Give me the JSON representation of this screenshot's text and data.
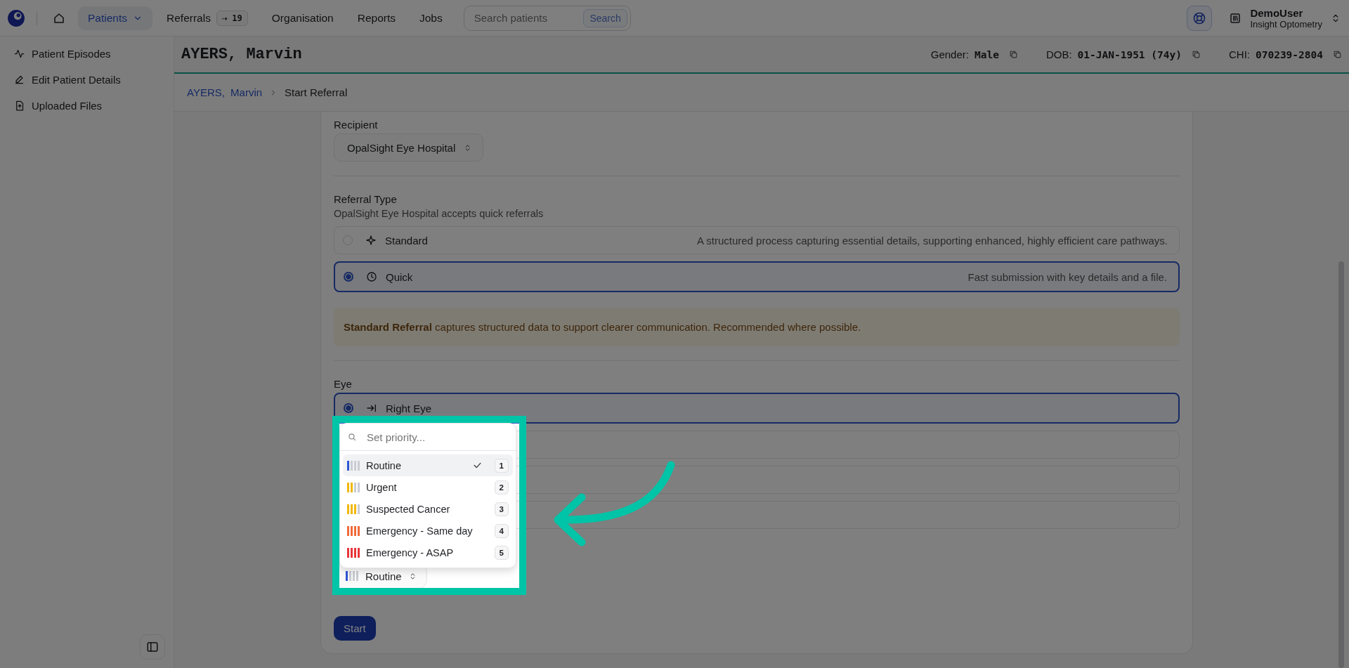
{
  "topbar": {
    "nav": [
      {
        "label": "Patients",
        "selected": true,
        "kind": "menu"
      },
      {
        "label": "Referrals",
        "badge": "⇢ 19",
        "selected": false,
        "kind": "badge"
      },
      {
        "label": "Organisation",
        "selected": false,
        "kind": "plain"
      },
      {
        "label": "Reports",
        "selected": false,
        "kind": "plain"
      },
      {
        "label": "Jobs",
        "selected": false,
        "kind": "plain"
      }
    ],
    "search": {
      "placeholder": "Search patients",
      "button": "Search"
    },
    "user": {
      "name": "DemoUser",
      "org": "Insight Optometry"
    }
  },
  "sidebar": {
    "items": [
      {
        "label": "Patient Episodes",
        "kind": "pulse"
      },
      {
        "label": "Edit Patient Details",
        "kind": "pen"
      },
      {
        "label": "Uploaded Files",
        "kind": "file"
      }
    ]
  },
  "patient": {
    "name": "AYERS, Marvin",
    "details": [
      {
        "label": "Gender:",
        "value": "Male"
      },
      {
        "label": "DOB:",
        "value": "01-JAN-1951 (74y)"
      },
      {
        "label": "CHI:",
        "value": "070239-2804"
      }
    ]
  },
  "breadcrumb": [
    {
      "label": "AYERS, Marvin",
      "link": true
    },
    {
      "label": "Start Referral",
      "link": false
    }
  ],
  "form": {
    "recipient": {
      "label": "Recipient",
      "value": "OpalSight Eye Hospital"
    },
    "referral_type": {
      "label": "Referral Type",
      "hint": "OpalSight Eye Hospital accepts quick referrals",
      "options": [
        {
          "label": "Standard",
          "description": "A structured process capturing essential details, supporting enhanced, highly efficient care pathways.",
          "selected": false,
          "kind": "sparkle"
        },
        {
          "label": "Quick",
          "description": "Fast submission with key details and a file.",
          "selected": true,
          "kind": "clock"
        }
      ]
    },
    "notice": "**Standard Referral** captures structured data to support clearer communication. Recommended where possible.",
    "eye": {
      "label": "Eye",
      "options": [
        {
          "label": "Right Eye",
          "selected": true,
          "kind": "arrow"
        },
        {
          "kind": "covered"
        },
        {
          "kind": "covered"
        },
        {
          "kind": "covered"
        }
      ]
    },
    "priority": {
      "value": "Routine",
      "color": "#2f55d4",
      "level": 0.25
    },
    "start_button": "Start"
  },
  "priority_menu": {
    "placeholder": "Set priority...",
    "items": [
      {
        "label": "Routine",
        "shortcut": "1",
        "color": "#2f55d4",
        "level": 0.25,
        "selected": true
      },
      {
        "label": "Urgent",
        "shortcut": "2",
        "color": "#f2b705",
        "level": 0.5,
        "selected": false
      },
      {
        "label": "Suspected Cancer",
        "shortcut": "3",
        "color": "#f2b705",
        "level": 0.75,
        "selected": false
      },
      {
        "label": "Emergency - Same day",
        "shortcut": "4",
        "color": "#ef6a3a",
        "level": 1,
        "selected": false
      },
      {
        "label": "Emergency - ASAP",
        "shortcut": "5",
        "color": "#e8343a",
        "level": 1,
        "selected": false
      }
    ]
  }
}
